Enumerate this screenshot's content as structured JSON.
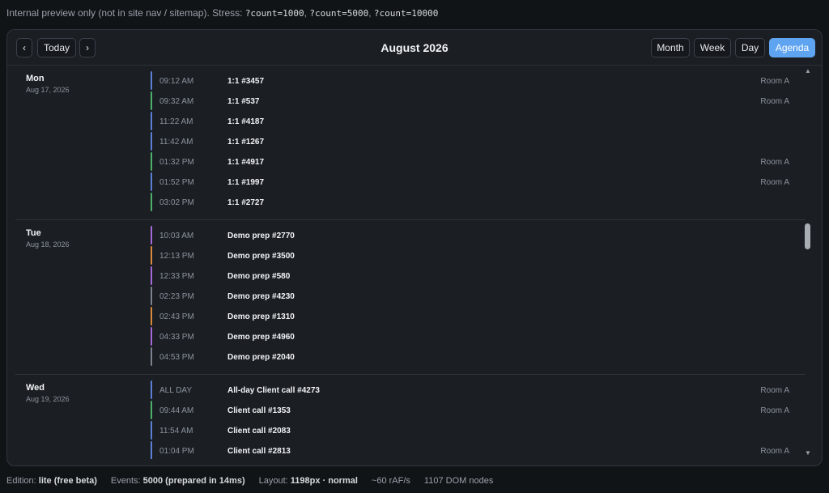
{
  "notice": {
    "text": "Internal preview only (not in site nav / sitemap). Stress:",
    "stress_links": [
      "?count=1000",
      "?count=5000",
      "?count=10000"
    ]
  },
  "toolbar": {
    "prev_label": "‹",
    "today_label": "Today",
    "next_label": "›",
    "title": "August 2026",
    "views": [
      {
        "label": "Month",
        "active": false
      },
      {
        "label": "Week",
        "active": false
      },
      {
        "label": "Day",
        "active": false
      },
      {
        "label": "Agenda",
        "active": true
      }
    ]
  },
  "colors": {
    "blue": "#5b7fd6",
    "green": "#4caf6a",
    "purple": "#a569d9",
    "orange": "#d9893a",
    "gray": "#7c838c",
    "accent": "#5fa4f0"
  },
  "days": [
    {
      "name": "Mon",
      "date": "Aug 17, 2026",
      "events": [
        {
          "time": "09:12 AM",
          "title": "1:1 #3457",
          "room": "Room A",
          "color": "#5b7fd6"
        },
        {
          "time": "09:32 AM",
          "title": "1:1 #537",
          "room": "Room A",
          "color": "#4caf6a"
        },
        {
          "time": "11:22 AM",
          "title": "1:1 #4187",
          "room": "",
          "color": "#5b7fd6"
        },
        {
          "time": "11:42 AM",
          "title": "1:1 #1267",
          "room": "",
          "color": "#5b7fd6"
        },
        {
          "time": "01:32 PM",
          "title": "1:1 #4917",
          "room": "Room A",
          "color": "#4caf6a"
        },
        {
          "time": "01:52 PM",
          "title": "1:1 #1997",
          "room": "Room A",
          "color": "#5b7fd6"
        },
        {
          "time": "03:02 PM",
          "title": "1:1 #2727",
          "room": "",
          "color": "#4caf6a"
        }
      ]
    },
    {
      "name": "Tue",
      "date": "Aug 18, 2026",
      "events": [
        {
          "time": "10:03 AM",
          "title": "Demo prep #2770",
          "room": "",
          "color": "#a569d9"
        },
        {
          "time": "12:13 PM",
          "title": "Demo prep #3500",
          "room": "",
          "color": "#d9893a"
        },
        {
          "time": "12:33 PM",
          "title": "Demo prep #580",
          "room": "",
          "color": "#a569d9"
        },
        {
          "time": "02:23 PM",
          "title": "Demo prep #4230",
          "room": "",
          "color": "#7c838c"
        },
        {
          "time": "02:43 PM",
          "title": "Demo prep #1310",
          "room": "",
          "color": "#d9893a"
        },
        {
          "time": "04:33 PM",
          "title": "Demo prep #4960",
          "room": "",
          "color": "#a569d9"
        },
        {
          "time": "04:53 PM",
          "title": "Demo prep #2040",
          "room": "",
          "color": "#7c838c"
        }
      ]
    },
    {
      "name": "Wed",
      "date": "Aug 19, 2026",
      "events": [
        {
          "time": "ALL DAY",
          "title": "All-day Client call #4273",
          "room": "Room A",
          "color": "#5b7fd6"
        },
        {
          "time": "09:44 AM",
          "title": "Client call #1353",
          "room": "Room A",
          "color": "#4caf6a"
        },
        {
          "time": "11:54 AM",
          "title": "Client call #2083",
          "room": "",
          "color": "#5b7fd6"
        },
        {
          "time": "01:04 PM",
          "title": "Client call #2813",
          "room": "Room A",
          "color": "#5b7fd6"
        }
      ]
    }
  ],
  "scrollbar": {
    "up": "▲",
    "down": "▼"
  },
  "status": [
    {
      "label": "Edition:",
      "value": "lite (free beta)"
    },
    {
      "label": "Events:",
      "value": "5000 (prepared in 14ms)"
    },
    {
      "label": "Layout:",
      "value": "1198px · normal"
    },
    {
      "label": "",
      "value": "~60 rAF/s"
    },
    {
      "label": "",
      "value": "1107 DOM nodes"
    }
  ]
}
